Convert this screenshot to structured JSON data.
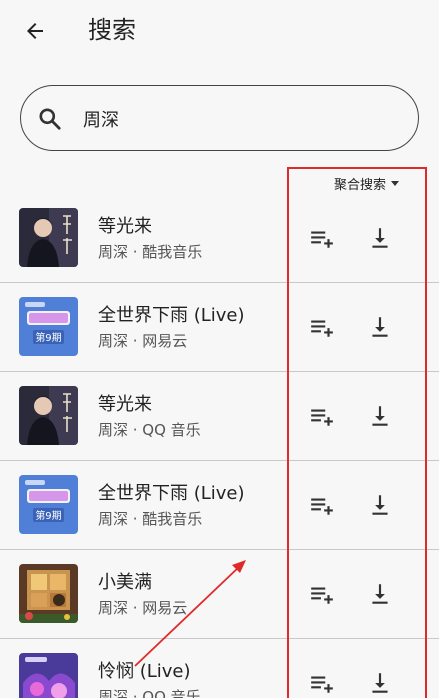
{
  "header": {
    "title": "搜索",
    "back_icon": "arrow-left-icon"
  },
  "search": {
    "value": "周深",
    "icon": "search-icon"
  },
  "source_select": {
    "label": "聚合搜索"
  },
  "songs": [
    {
      "title": "等光来",
      "subtitle": "周深 · 酷我音乐",
      "cover": "portrait-cover"
    },
    {
      "title": "全世界下雨 (Live)",
      "subtitle": "周深 · 网易云",
      "cover": "show-cover"
    },
    {
      "title": "等光来",
      "subtitle": "周深 · QQ 音乐",
      "cover": "portrait-cover"
    },
    {
      "title": "全世界下雨 (Live)",
      "subtitle": "周深 · 酷我音乐",
      "cover": "show-cover"
    },
    {
      "title": "小美满",
      "subtitle": "周深 · 网易云",
      "cover": "window-cover"
    },
    {
      "title": "怜悯 (Live)",
      "subtitle": "周深 · QQ 音乐",
      "cover": "stage-cover"
    }
  ],
  "cover_badges": {
    "show": "第9期"
  },
  "colors": {
    "highlight": "#e02a2a",
    "background": "#f7f7f7",
    "divider": "#c8c8c8"
  }
}
